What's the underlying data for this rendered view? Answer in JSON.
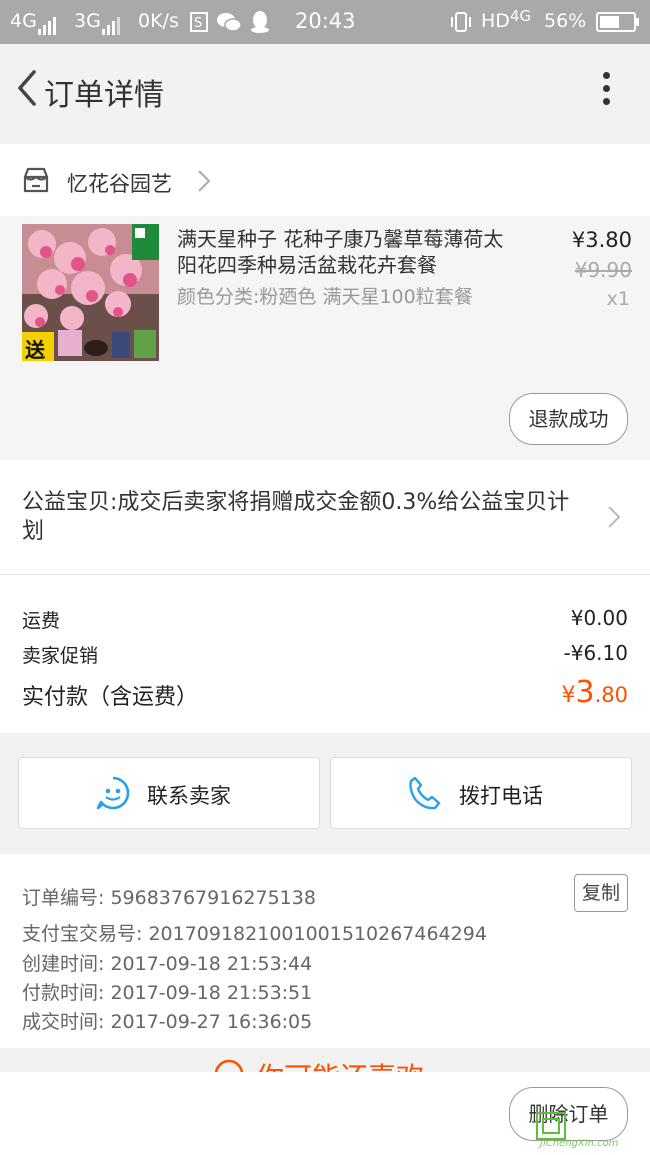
{
  "status_bar": {
    "net1": "4G",
    "net2": "3G",
    "speed": "0K/s",
    "time": "20:43",
    "hd": "HD",
    "net3": "4G",
    "battery": "56%"
  },
  "header": {
    "title": "订单详情"
  },
  "shop": {
    "name": "忆花谷园艺"
  },
  "product": {
    "title": "满天星种子 花种子康乃馨草莓薄荷太阳花四季种易活盆栽花卉套餐",
    "attributes": "颜色分类:粉廼色 满天星100粒套餐",
    "price": "¥3.80",
    "original_price": "¥9.90",
    "quantity": "x1",
    "refund_status": "退款成功",
    "thumb_badge": "送"
  },
  "charity": {
    "text": "公益宝贝:成交后卖家将捐赠成交金额0.3%给公益宝贝计划"
  },
  "summary": {
    "shipping_label": "运费",
    "shipping_value": "¥0.00",
    "promo_label": "卖家促销",
    "promo_value": "-¥6.10",
    "total_label": "实付款（含运费）",
    "total_currency": "¥",
    "total_int": "3",
    "total_dec": ".80"
  },
  "actions": {
    "contact_label": "联系卖家",
    "call_label": "拨打电话"
  },
  "order_info": {
    "order_no": "订单编号: 59683767916275138",
    "copy_label": "复制",
    "alipay_no": "支付宝交易号: 2017091821001001510267464294",
    "created": "创建时间: 2017-09-18 21:53:44",
    "paid": "付款时间: 2017-09-18 21:53:51",
    "completed": "成交时间: 2017-09-27 16:36:05"
  },
  "recommend": {
    "text": "你可能还喜欢"
  },
  "footer": {
    "delete_label": "删除订单"
  },
  "watermark": {
    "text": "JiChengXin.com"
  },
  "colors": {
    "accent": "#ff5000",
    "icon_blue": "#29a1e8"
  }
}
